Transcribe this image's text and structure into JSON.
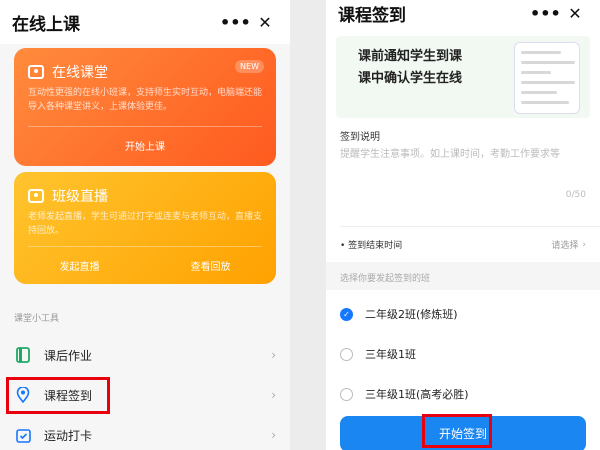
{
  "left": {
    "title": "在线上课",
    "more_icon": "•••",
    "close_icon": "✕",
    "card1": {
      "title": "在线课堂",
      "badge": "NEW",
      "desc": "互动性更强的在线小班课，支持师生实时互动，电脑端还能导入各种课堂讲义，上课体验更佳。",
      "button": "开始上课",
      "color": "#ff6a2a"
    },
    "card2": {
      "title": "班级直播",
      "desc": "老师发起直播，学生可通过打字或连麦与老师互动，直播支持回放。",
      "button_left": "发起直播",
      "button_right": "查看回放",
      "color": "#ffb314"
    },
    "section_label": "课堂小工具",
    "tools": [
      {
        "icon": "book-icon",
        "label": "课后作业"
      },
      {
        "icon": "location-pin-icon",
        "label": "课程签到"
      },
      {
        "icon": "calendar-check-icon",
        "label": "运动打卡"
      }
    ]
  },
  "right": {
    "title": "课程签到",
    "more_icon": "•••",
    "close_icon": "✕",
    "banner_line1": "课前通知学生到课",
    "banner_line2": "课中确认学生在线",
    "field_label": "签到说明",
    "field_placeholder": "提醒学生注意事项。如上课时间，考勤工作要求等",
    "field_count": "0/50",
    "end_time_label": "• 签到结束时间",
    "end_time_value": "请选择",
    "class_section": "选择你要发起签到的班",
    "classes": [
      {
        "label": "二年级2班(修炼班)",
        "checked": true
      },
      {
        "label": "三年级1班",
        "checked": false
      },
      {
        "label": "三年级1班(高考必胜)",
        "checked": false
      }
    ],
    "start_button": "开始签到",
    "accent": "#1677ff"
  }
}
